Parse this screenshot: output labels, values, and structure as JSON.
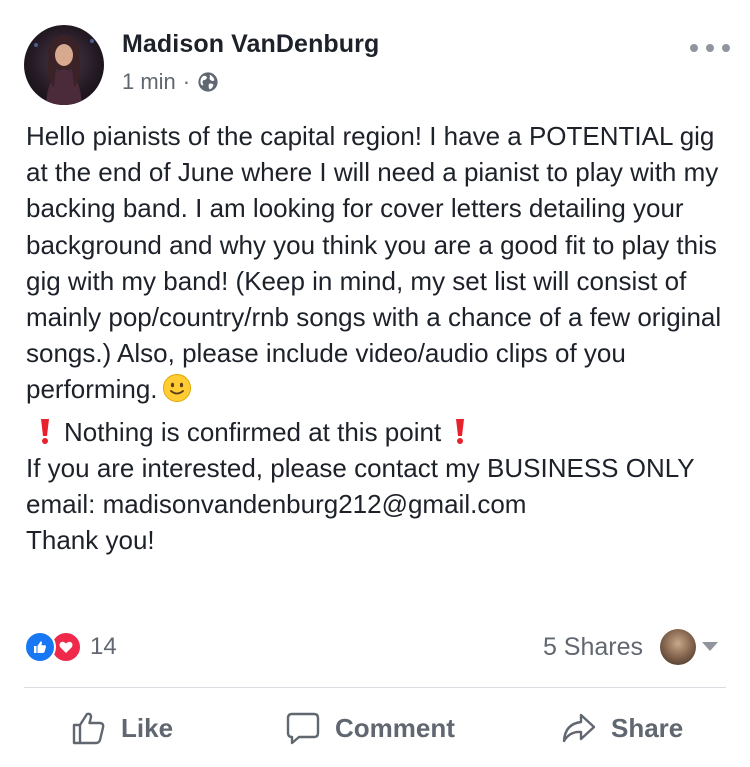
{
  "post": {
    "author": "Madison VanDenburg",
    "time": "1 min",
    "separator": "·",
    "privacy_icon": "globe-icon",
    "more_icon": "ellipsis-icon",
    "body": {
      "paragraph1": "Hello pianists of the capital region! I have a POTENTIAL gig at the end of June where I will need a pianist to play with my backing band. I am looking for cover letters detailing your background and why you think you are a good fit to play this gig with my band! (Keep in mind, my set list will consist of mainly pop/country/rnb songs with a chance of a few original songs.) Also, please include video/audio clips of you performing.",
      "emoji": "slightly-smiling-face-icon",
      "notice": "Nothing is confirmed at this point",
      "notice_icon": "red-exclamation-icon",
      "contact": "If you are interested, please contact my BUSINESS ONLY email: madisonvandenburg212@gmail.com",
      "thanks": "Thank you!"
    }
  },
  "engagement": {
    "reaction_count": "14",
    "reaction_icons": [
      "like-reaction-icon",
      "love-reaction-icon"
    ],
    "shares": "5 Shares"
  },
  "actions": {
    "like": "Like",
    "comment": "Comment",
    "share": "Share"
  },
  "colors": {
    "like_blue": "#1877f2",
    "love_red": "#f0284a",
    "text": "#1d2129",
    "secondary": "#616770"
  }
}
